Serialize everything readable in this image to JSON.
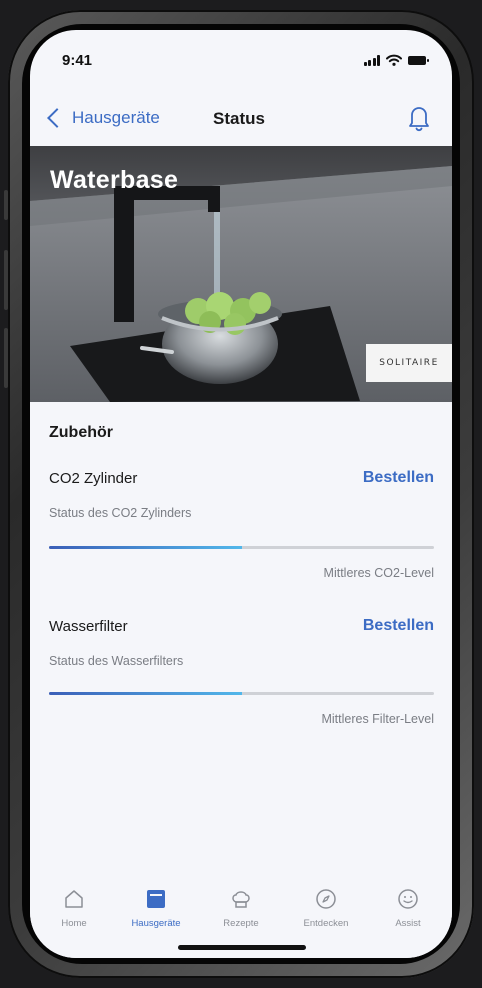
{
  "status_bar": {
    "time": "9:41"
  },
  "nav": {
    "back_label": "Hausgeräte",
    "title": "Status"
  },
  "hero": {
    "title": "Waterbase",
    "brand_logo_text": "SOLITAIRE"
  },
  "accessories": {
    "section_title": "Zubehör",
    "items": [
      {
        "name": "CO2 Zylinder",
        "order_label": "Bestellen",
        "description": "Status des CO2 Zylinders",
        "level_label": "Mittleres CO2-Level",
        "level_fraction": 0.5
      },
      {
        "name": "Wasserfilter",
        "order_label": "Bestellen",
        "description": "Status des Wasserfilters",
        "level_label": "Mittleres Filter-Level",
        "level_fraction": 0.5
      }
    ]
  },
  "tabbar": {
    "active": "Hausgeräte",
    "tabs": [
      {
        "label": "Home",
        "icon": "house-icon"
      },
      {
        "label": "Hausgeräte",
        "icon": "appliance-icon"
      },
      {
        "label": "Rezepte",
        "icon": "chef-hat-icon"
      },
      {
        "label": "Entdecken",
        "icon": "compass-icon"
      },
      {
        "label": "Assist",
        "icon": "smiley-icon"
      }
    ]
  },
  "colors": {
    "accent": "#3c6cc4",
    "background": "#f5f6fa",
    "muted_text": "#7a7d84"
  }
}
